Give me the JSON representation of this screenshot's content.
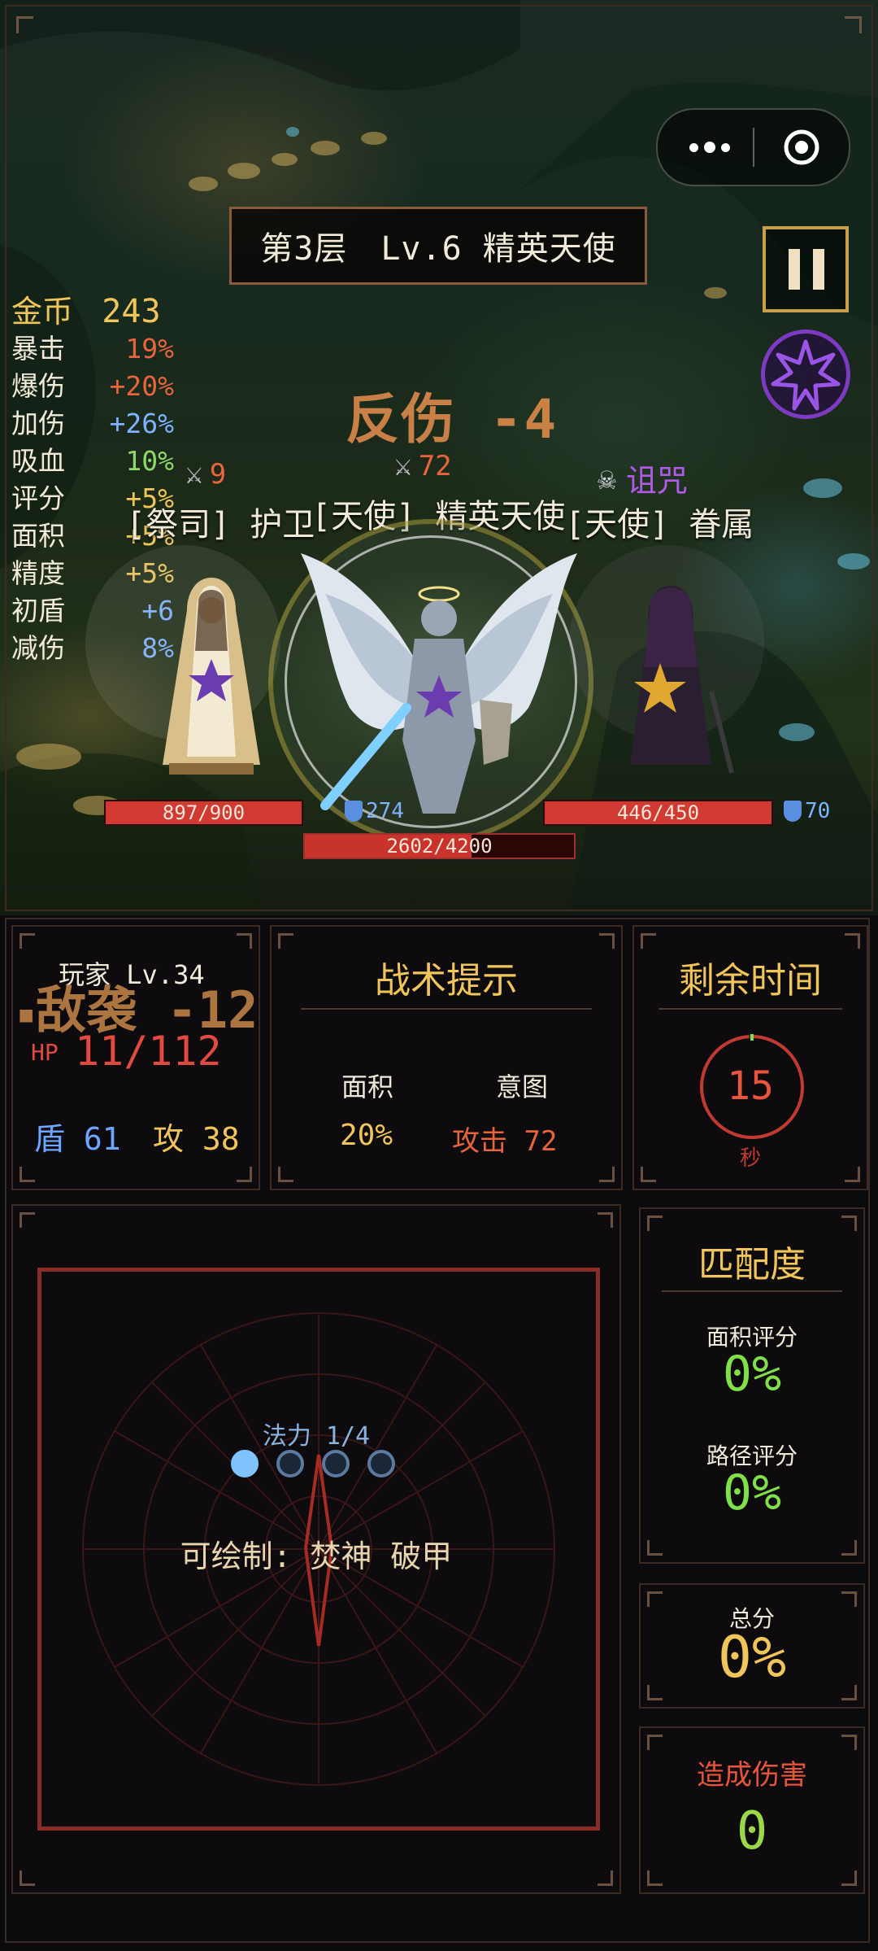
{
  "hud": {
    "floor_banner": "第3层　Lv.6 精英天使",
    "gold_label": "金币",
    "gold_value": "243",
    "stats": [
      {
        "label": "暴击",
        "value": "19%",
        "color": "#e8643c"
      },
      {
        "label": "爆伤",
        "value": "+20%",
        "color": "#e8643c"
      },
      {
        "label": "加伤",
        "value": "+26%",
        "color": "#7fb2ff"
      },
      {
        "label": "吸血",
        "value": "10%",
        "color": "#8fd86a"
      },
      {
        "label": "评分",
        "value": "+5%",
        "color": "#f0c55a"
      },
      {
        "label": "面积",
        "value": "+5%",
        "color": "#f0c55a"
      },
      {
        "label": "精度",
        "value": "+5%",
        "color": "#f0c55a"
      },
      {
        "label": "初盾",
        "value": "+6",
        "color": "#7fb2ff"
      },
      {
        "label": "减伤",
        "value": "8%",
        "color": "#7fb2ff"
      }
    ]
  },
  "battle": {
    "reflect_text": "反伤 -4",
    "enemies": [
      {
        "name": "[祭司] 护卫",
        "attack": "9",
        "hp": "897/900",
        "hp_fraction": 0.997,
        "shield": "274"
      },
      {
        "name": "[天使] 精英天使",
        "attack": "72",
        "hp": "2602/4200",
        "hp_fraction": 0.62
      },
      {
        "name": "[天使] 眷属",
        "status": "诅咒",
        "hp": "446/450",
        "hp_fraction": 0.991,
        "shield": "70"
      }
    ]
  },
  "player": {
    "title": "玩家  Lv.34",
    "ambush": "敌袭 -12",
    "hp_label": "HP",
    "hp_value": "11/112",
    "shield_label": "盾",
    "shield_value": "61",
    "attack_label": "攻",
    "attack_value": "38"
  },
  "tactics": {
    "title": "战术提示",
    "area_label": "面积",
    "area_value": "20%",
    "intent_label": "意图",
    "intent_value": "攻击 72"
  },
  "timer": {
    "title": "剩余时间",
    "seconds": "15",
    "unit": "秒",
    "fraction_remaining": 0.99
  },
  "draw": {
    "mana_label": "法力 1/4",
    "mana_filled": 1,
    "mana_total": 4,
    "drawable": "可绘制: 焚神 破甲"
  },
  "match": {
    "title": "匹配度",
    "area_score_label": "面积评分",
    "area_score": "0%",
    "path_score_label": "路径评分",
    "path_score": "0%",
    "total_label": "总分",
    "total": "0%",
    "damage_label": "造成伤害",
    "damage": "0"
  }
}
